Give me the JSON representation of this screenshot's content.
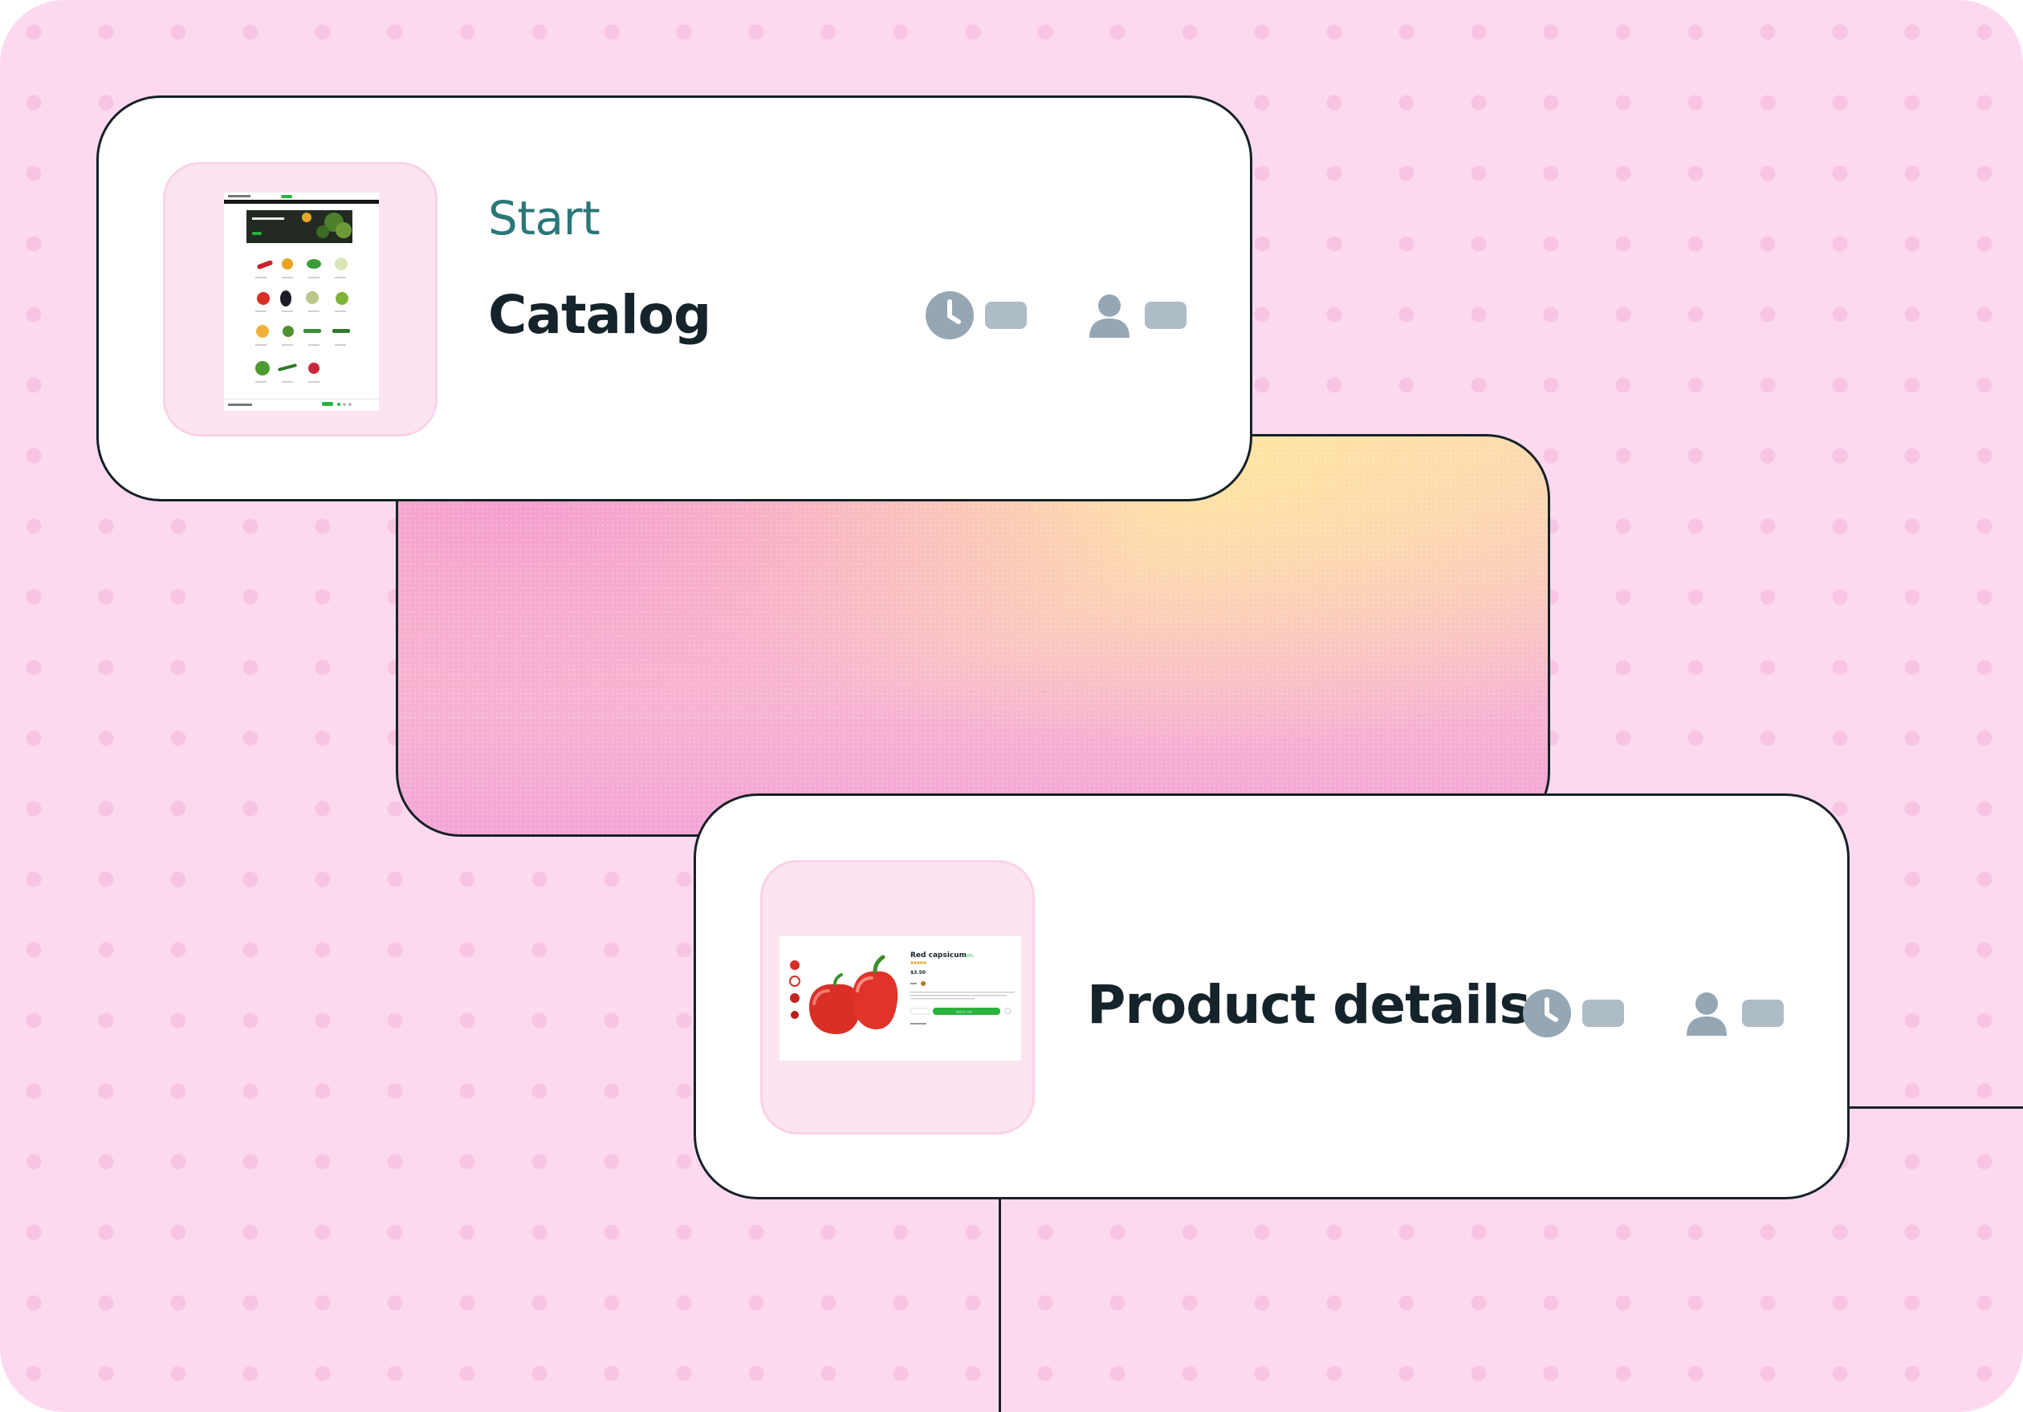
{
  "flow": {
    "steps": [
      {
        "tag": "Start",
        "title": "Catalog",
        "thumbnail": "catalog-page-thumbnail",
        "meta": [
          {
            "icon": "clock-icon"
          },
          {
            "icon": "user-icon"
          }
        ]
      },
      {
        "title": "Product details",
        "thumbnail": "product-page-thumbnail",
        "thumbnail_text": {
          "product_name": "Red capsicum",
          "badge": "-10%",
          "price": "$3.50",
          "button": "Add to Cart"
        },
        "meta": [
          {
            "icon": "clock-icon"
          },
          {
            "icon": "user-icon"
          }
        ]
      }
    ]
  },
  "colors": {
    "background": "#fdd9ef",
    "dots": "#f7c5e1",
    "card": "#ffffff",
    "outline": "#152126",
    "tag": "#2a7779",
    "title": "#15232b",
    "placeholder": "#aebcc6",
    "thumb_frame": "#fde4f1",
    "accent_green": "#27b33c",
    "accent_red": "#d92f26"
  }
}
